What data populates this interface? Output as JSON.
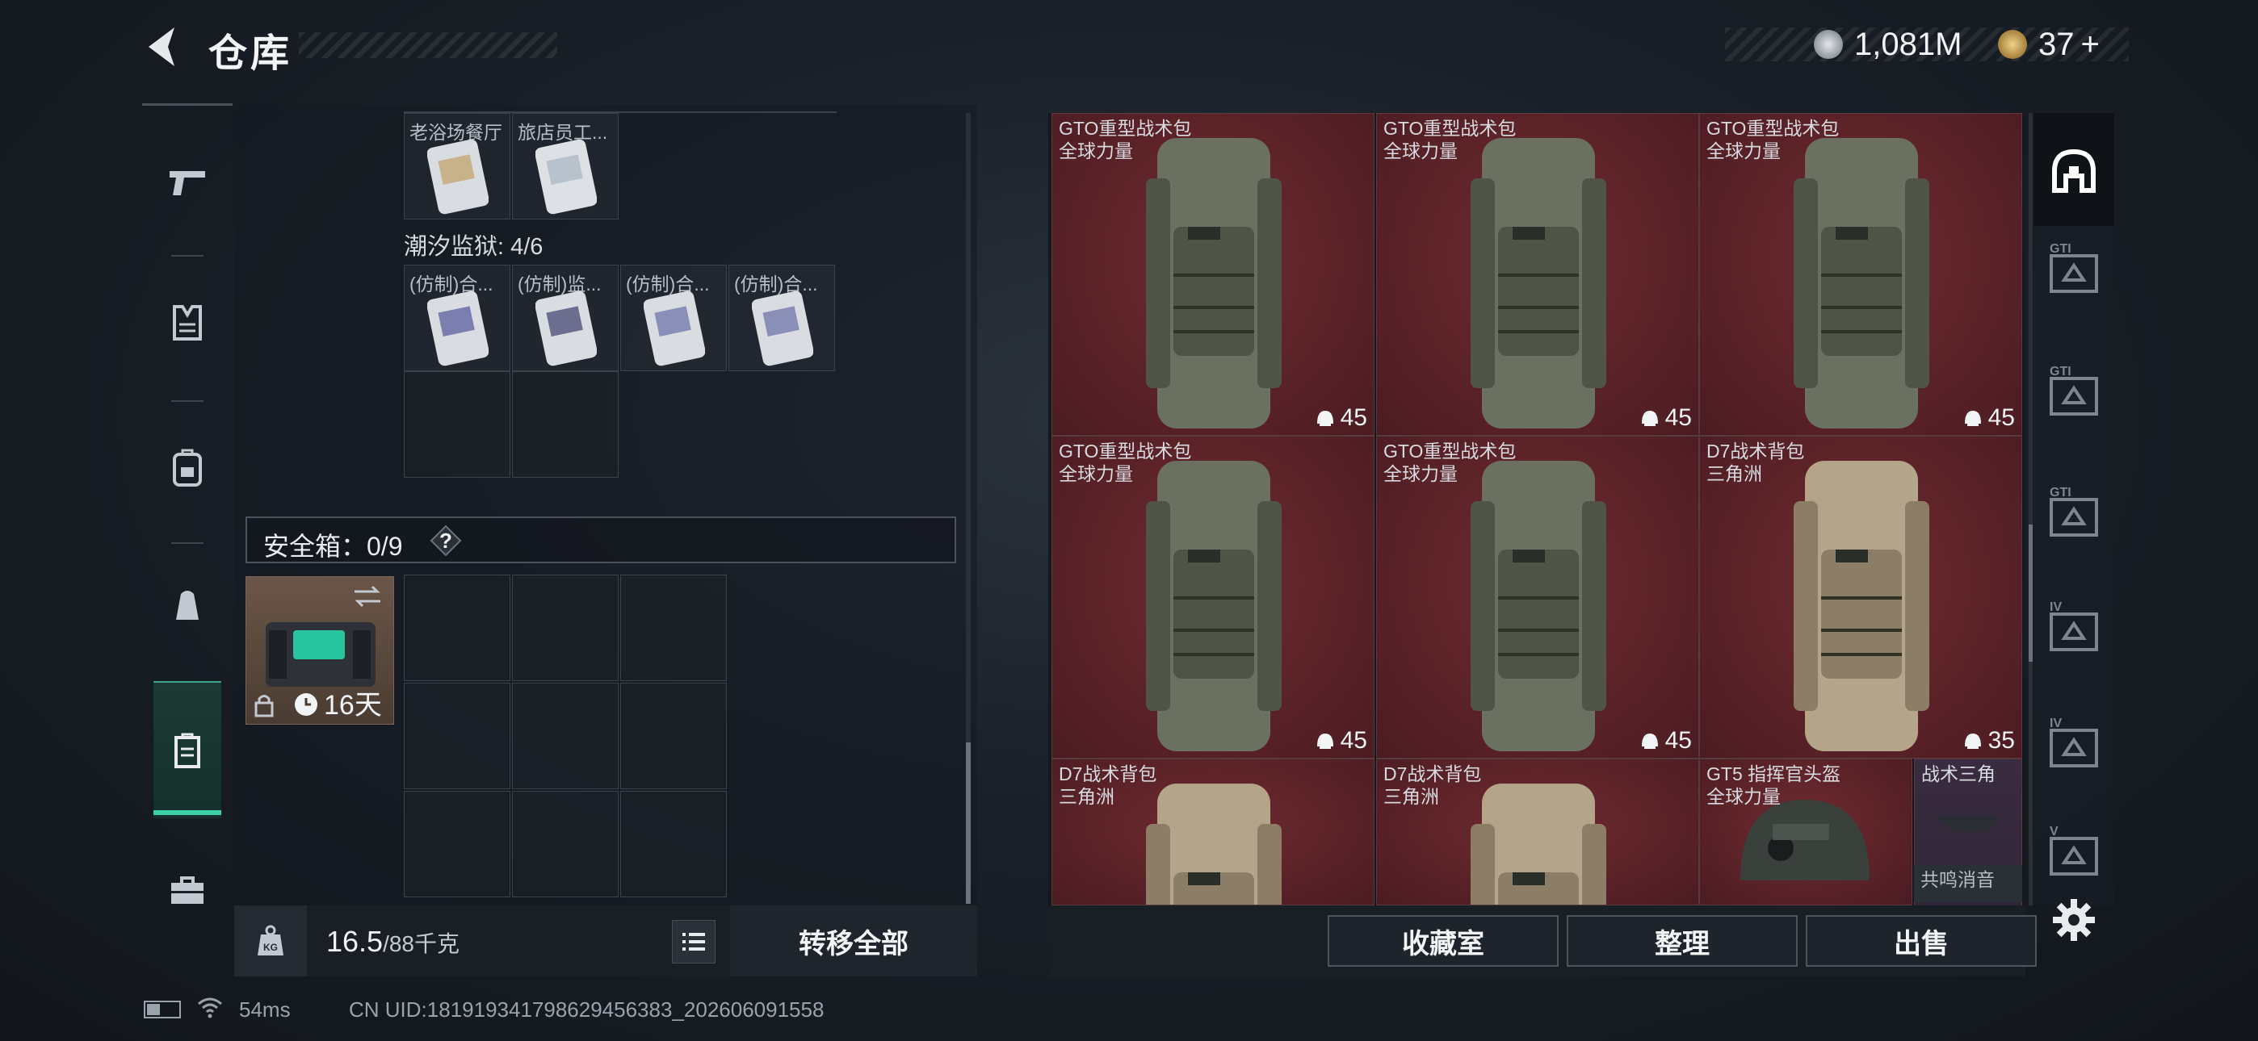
{
  "header": {
    "title": "仓库"
  },
  "currency": {
    "coins": "1,081M",
    "tokens": "37",
    "tokens_plus": "+"
  },
  "left_nav": {
    "items": [
      "pistol-icon",
      "armor-vest-icon",
      "backpack-icon",
      "pouch-icon",
      "safebox-icon",
      "toolbox-icon"
    ],
    "active_index": 4
  },
  "inventory": {
    "row1": [
      "老浴场餐厅",
      "旅店员工..."
    ],
    "prison_label": "潮汐监狱: 4/6",
    "row2": [
      "(仿制)合...",
      "(仿制)监...",
      "(仿制)合...",
      "(仿制)合..."
    ],
    "safe_label": "安全箱：0/9",
    "safe_help": "?",
    "safebox_days": "16天"
  },
  "bottom_left": {
    "weight": "16.5",
    "weight_max": "/88千克",
    "transfer_label": "转移全部"
  },
  "storage_items": [
    {
      "name": "GTO重型战术包",
      "source": "全球力量",
      "count": "45"
    },
    {
      "name": "GTO重型战术包",
      "source": "全球力量",
      "count": "45"
    },
    {
      "name": "GTO重型战术包",
      "source": "全球力量",
      "count": "45"
    },
    {
      "name": "GTO重型战术包",
      "source": "全球力量",
      "count": "45"
    },
    {
      "name": "GTO重型战术包",
      "source": "全球力量",
      "count": "45"
    },
    {
      "name": "D7战术背包",
      "source": "三角洲",
      "count": "35"
    },
    {
      "name": "D7战术背包",
      "source": "三角洲",
      "count": ""
    },
    {
      "name": "D7战术背包",
      "source": "三角洲",
      "count": ""
    },
    {
      "name": "GT5 指挥官头盔",
      "source": "全球力量",
      "count": ""
    }
  ],
  "small_items": [
    {
      "name": "战术三角"
    },
    {
      "name": "共鸣消音"
    }
  ],
  "bottom_right": {
    "collection_label": "收藏室",
    "sort_label": "整理",
    "sell_label": "出售"
  },
  "right_rail": {
    "items": [
      "GTI",
      "GTI",
      "GTI",
      "IV",
      "IV",
      "V"
    ]
  },
  "status": {
    "ping": "54ms",
    "uid": "CN UID:181919341798629456383_202606091558"
  },
  "colors": {
    "accent_green": "#3ccfa6",
    "item_bg_red": "#5a2228",
    "coin_silver": "#b9bfc6",
    "coin_gold": "#c9a253"
  }
}
